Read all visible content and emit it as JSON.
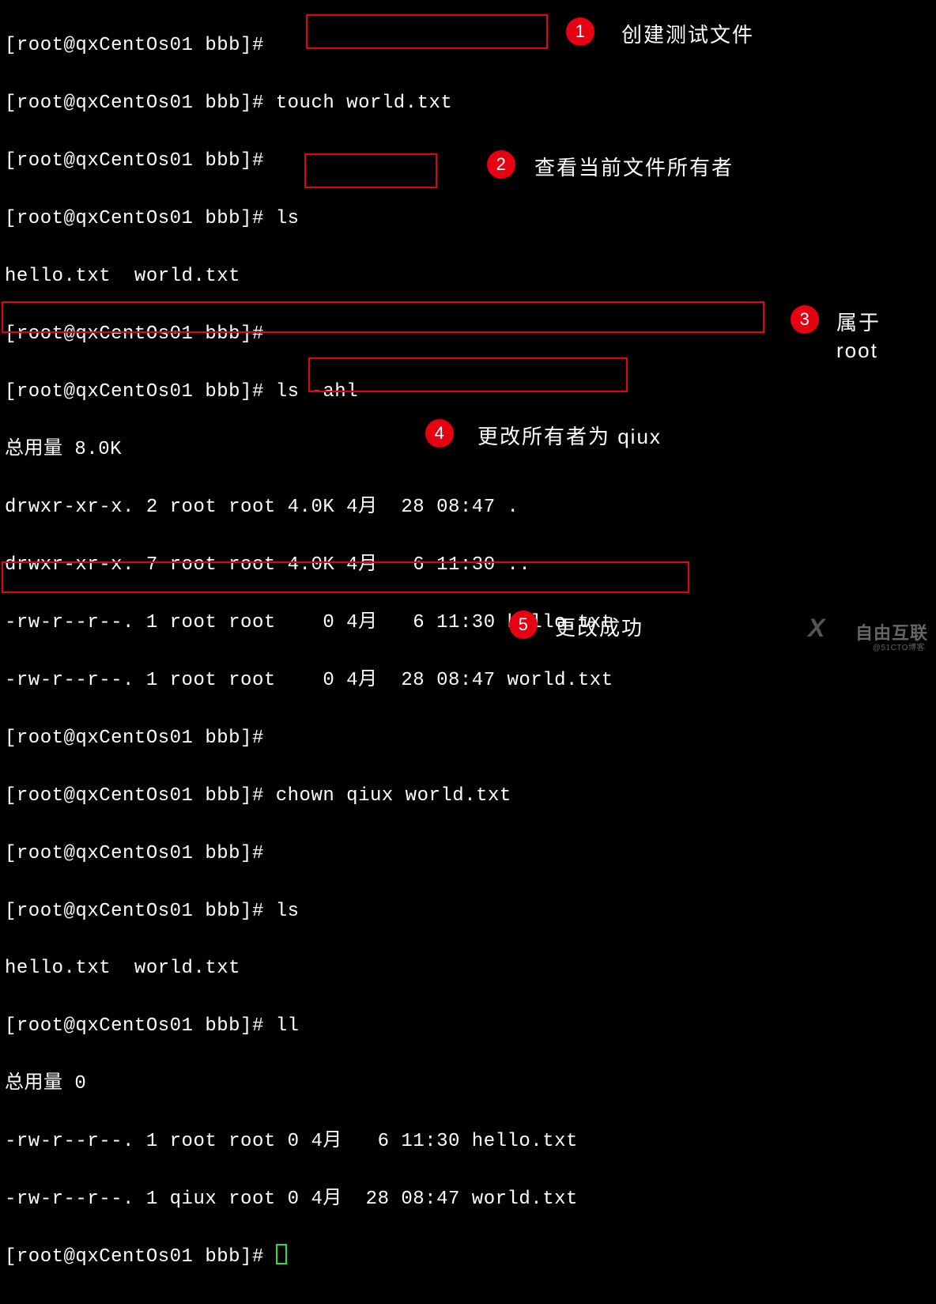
{
  "term": {
    "l0": "[root@qxCentOs01 bbb]#",
    "l1": "[root@qxCentOs01 bbb]# touch world.txt",
    "l2": "[root@qxCentOs01 bbb]#",
    "l3": "[root@qxCentOs01 bbb]# ls",
    "l4": "hello.txt  world.txt",
    "l5": "[root@qxCentOs01 bbb]#",
    "l6": "[root@qxCentOs01 bbb]# ls -ahl",
    "l7": "总用量 8.0K",
    "l8": "drwxr-xr-x. 2 root root 4.0K 4月  28 08:47 .",
    "l9": "drwxr-xr-x. 7 root root 4.0K 4月   6 11:30 ..",
    "l10": "-rw-r--r--. 1 root root    0 4月   6 11:30 hello.txt",
    "l11": "-rw-r--r--. 1 root root    0 4月  28 08:47 world.txt",
    "l12": "[root@qxCentOs01 bbb]#",
    "l13": "[root@qxCentOs01 bbb]# chown qiux world.txt",
    "l14": "[root@qxCentOs01 bbb]#",
    "l15": "[root@qxCentOs01 bbb]# ls",
    "l16": "hello.txt  world.txt",
    "l17": "[root@qxCentOs01 bbb]# ll",
    "l18": "总用量 0",
    "l19": "-rw-r--r--. 1 root root 0 4月   6 11:30 hello.txt",
    "l20": "-rw-r--r--. 1 qiux root 0 4月  28 08:47 world.txt",
    "l21": "[root@qxCentOs01 bbb]# "
  },
  "annotations": {
    "b1": "1",
    "b2": "2",
    "b3": "3",
    "b4": "4",
    "b5": "5",
    "t1": "创建测试文件",
    "t2": "查看当前文件所有者",
    "t3a": "属于",
    "t3b": "root",
    "t4": "更改所有者为 qiux",
    "t5": "更改成功"
  },
  "watermark": {
    "main": "自由互联",
    "sub": "@51CTO博客",
    "x": "X"
  }
}
